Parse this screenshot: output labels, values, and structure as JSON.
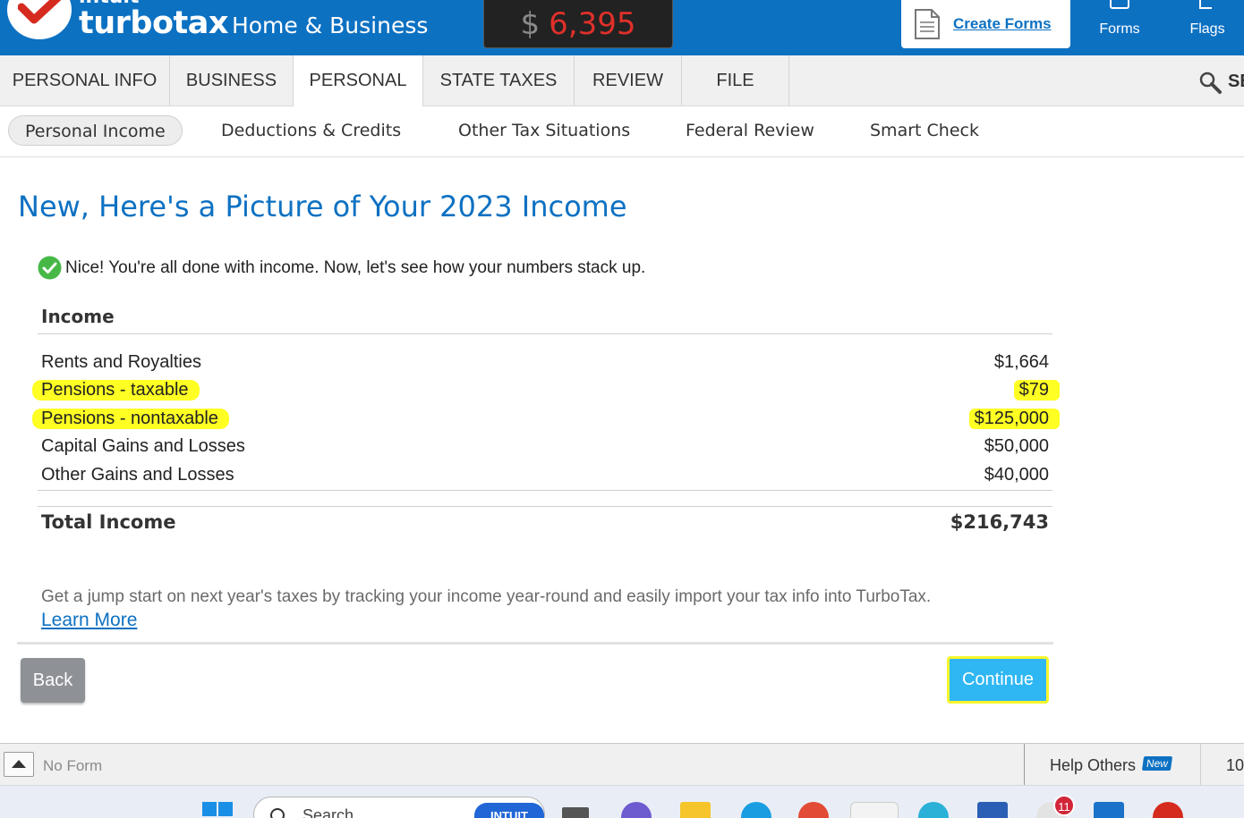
{
  "header": {
    "brand_top": "intuit",
    "brand_name": "turbotax",
    "brand_edition": "Home & Business",
    "refund_currency": "$",
    "refund_amount": "6,395",
    "create_forms_label": "Create Forms",
    "forms_label": "Forms",
    "flags_label": "Flags"
  },
  "main_nav": {
    "tabs": [
      "PERSONAL INFO",
      "BUSINESS",
      "PERSONAL",
      "STATE TAXES",
      "REVIEW",
      "FILE"
    ],
    "active": "PERSONAL",
    "search_label": "SEARCH"
  },
  "sub_nav": {
    "tabs": [
      "Personal Income",
      "Deductions & Credits",
      "Other Tax Situations",
      "Federal Review",
      "Smart Check"
    ],
    "active": "Personal Income"
  },
  "content": {
    "title": "New, Here's a Picture of Your 2023 Income",
    "done_message": "Nice! You're all done with income. Now, let's see how your numbers stack up.",
    "income_heading": "Income",
    "rows": [
      {
        "label": "Rents and Royalties",
        "value": "$1,664"
      },
      {
        "label": "Pensions - taxable",
        "value": "$79"
      },
      {
        "label": "Pensions - nontaxable",
        "value": "$125,000"
      },
      {
        "label": "Capital Gains and Losses",
        "value": "$50,000"
      },
      {
        "label": "Other Gains and Losses",
        "value": "$40,000"
      }
    ],
    "total_label": "Total Income",
    "total_value": "$216,743",
    "promo_text": "Get a jump start on next year's taxes by tracking your income year-round and easily import your tax info into TurboTax.",
    "learn_more": "Learn More",
    "back_label": "Back",
    "continue_label": "Continue"
  },
  "status_bar": {
    "no_form": "No Form",
    "help_others": "Help Others",
    "new_badge": "New",
    "page_num": "10"
  },
  "taskbar": {
    "search_text": "Search",
    "intuit_badge": "INTUIT",
    "notification_count": "11"
  },
  "colors": {
    "brand_blue": "#0d71c2",
    "refund_red": "#e0302a",
    "highlight_yellow": "#ffff24",
    "continue_blue": "#2fb7f3",
    "back_gray": "#8e9196"
  }
}
